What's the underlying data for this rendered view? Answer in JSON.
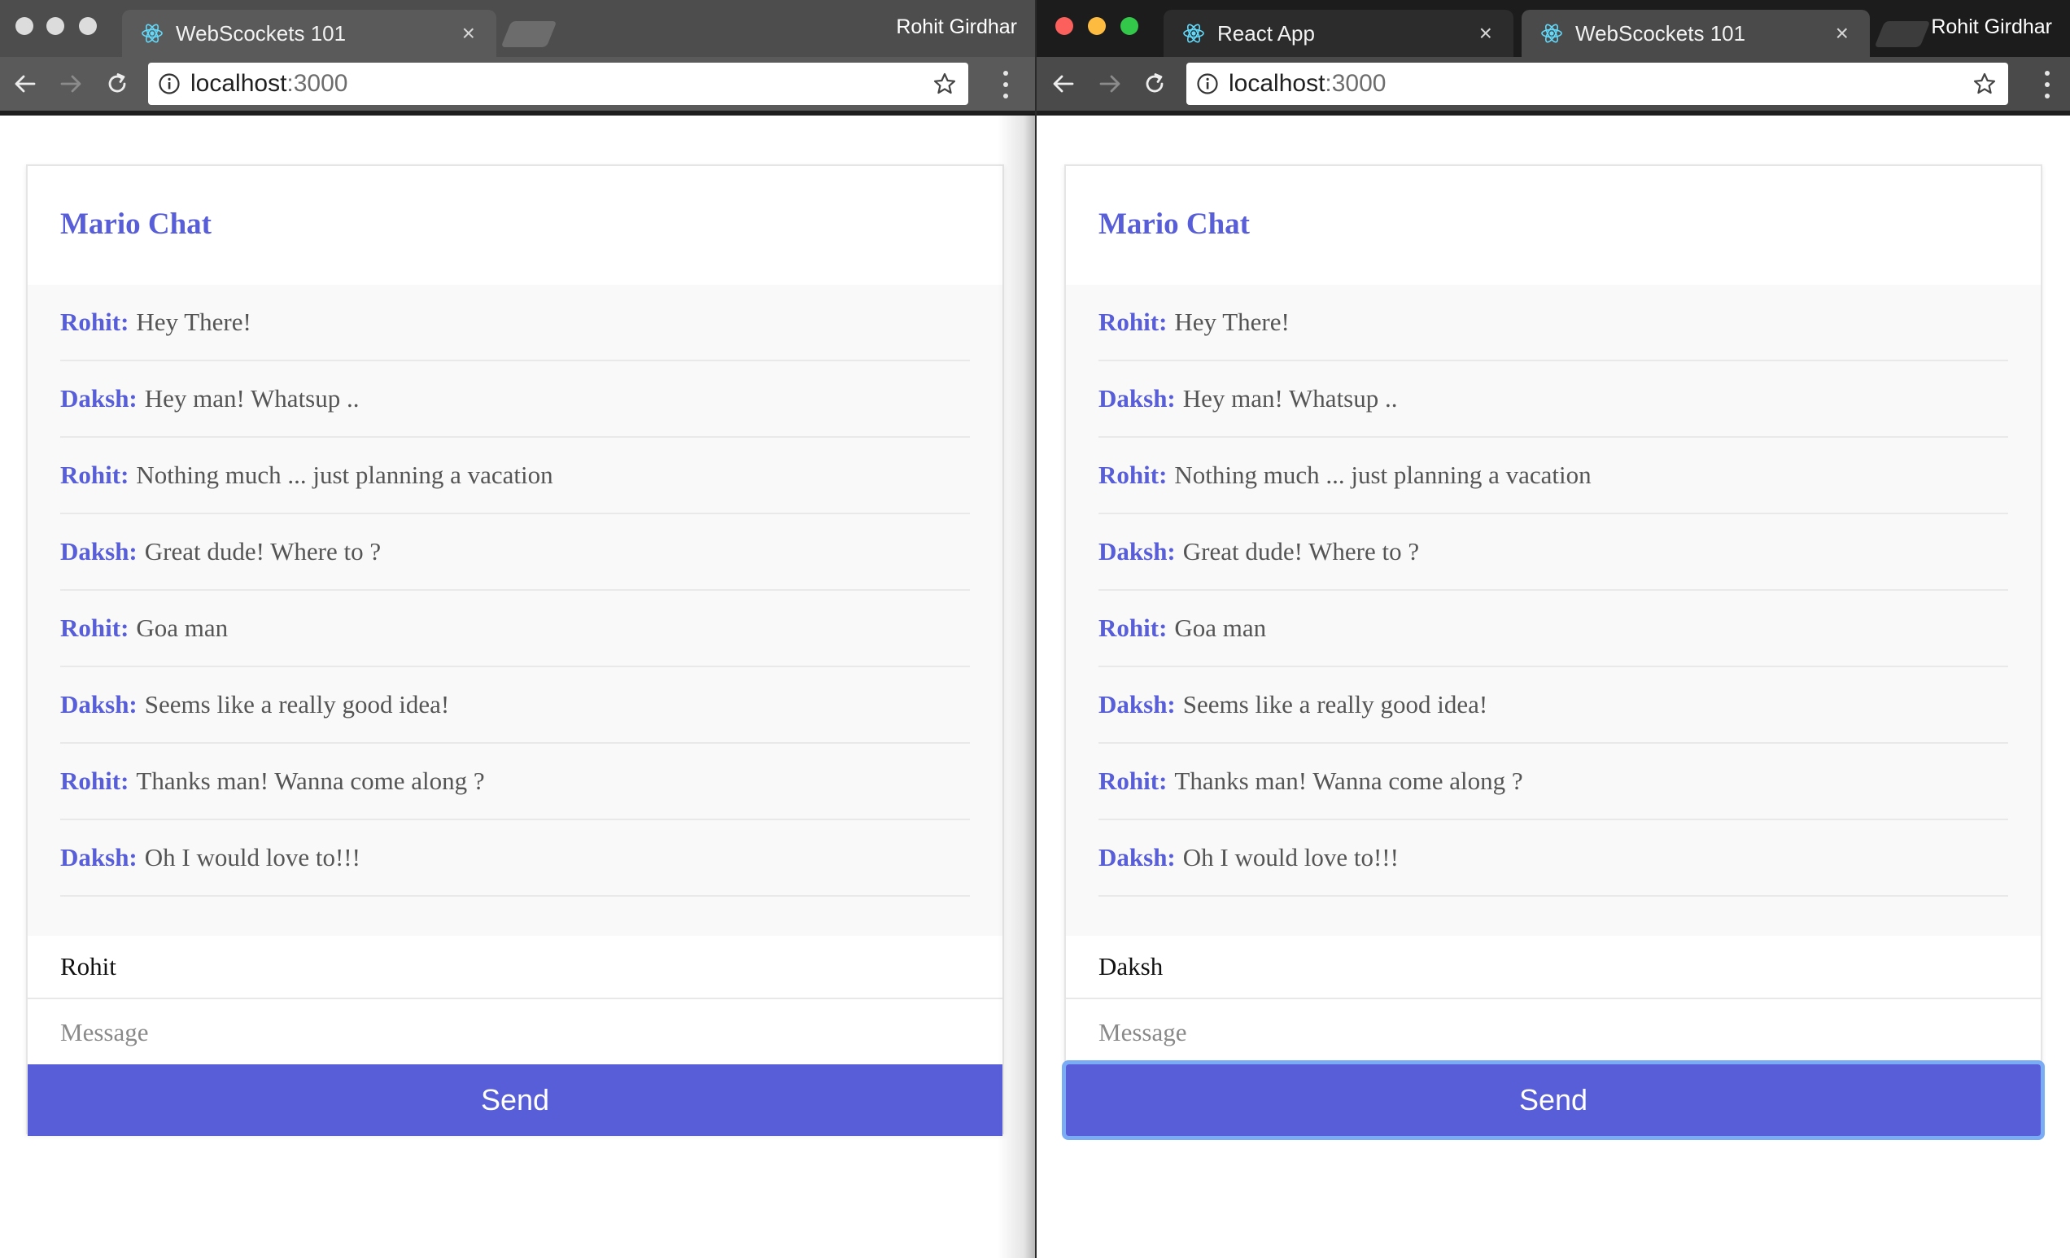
{
  "windows": [
    {
      "id": "left",
      "profile_name": "Rohit Girdhar",
      "tabs": [
        {
          "title": "WebScockets 101",
          "active": true
        }
      ],
      "url": {
        "host": "localhost",
        "port": ":3000"
      },
      "chat": {
        "title": "Mario Chat",
        "handle_value": "Rohit",
        "message_placeholder": "Message",
        "send_label": "Send",
        "send_focused": false
      }
    },
    {
      "id": "right",
      "profile_name": "Rohit Girdhar",
      "tabs": [
        {
          "title": "React App",
          "active": false
        },
        {
          "title": "WebScockets 101",
          "active": true
        }
      ],
      "url": {
        "host": "localhost",
        "port": ":3000"
      },
      "chat": {
        "title": "Mario Chat",
        "handle_value": "Daksh",
        "message_placeholder": "Message",
        "send_label": "Send",
        "send_focused": true
      }
    }
  ],
  "messages": [
    {
      "author": "Rohit:",
      "text": "Hey There!"
    },
    {
      "author": "Daksh:",
      "text": "Hey man! Whatsup .."
    },
    {
      "author": "Rohit:",
      "text": "Nothing much ... just planning a vacation"
    },
    {
      "author": "Daksh:",
      "text": "Great dude! Where to ?"
    },
    {
      "author": "Rohit:",
      "text": "Goa man"
    },
    {
      "author": "Daksh:",
      "text": "Seems like a really good idea!"
    },
    {
      "author": "Rohit:",
      "text": "Thanks man! Wanna come along ?"
    },
    {
      "author": "Daksh:",
      "text": "Oh I would love to!!!"
    }
  ],
  "icons": {
    "favicon": "react-icon",
    "back": "arrow-left-icon",
    "forward": "arrow-right-icon",
    "reload": "reload-icon",
    "info": "info-icon",
    "bookmark": "star-icon",
    "menu": "more-vertical-icon"
  },
  "colors": {
    "accent": "#575ed8",
    "chat_bg": "#f9f9f9",
    "focus_ring": "#7aabf5",
    "traffic_close": "#fc605c",
    "traffic_minimize": "#fdbc40",
    "traffic_zoom": "#34c84a",
    "traffic_inactive": "#dcdcdc"
  }
}
